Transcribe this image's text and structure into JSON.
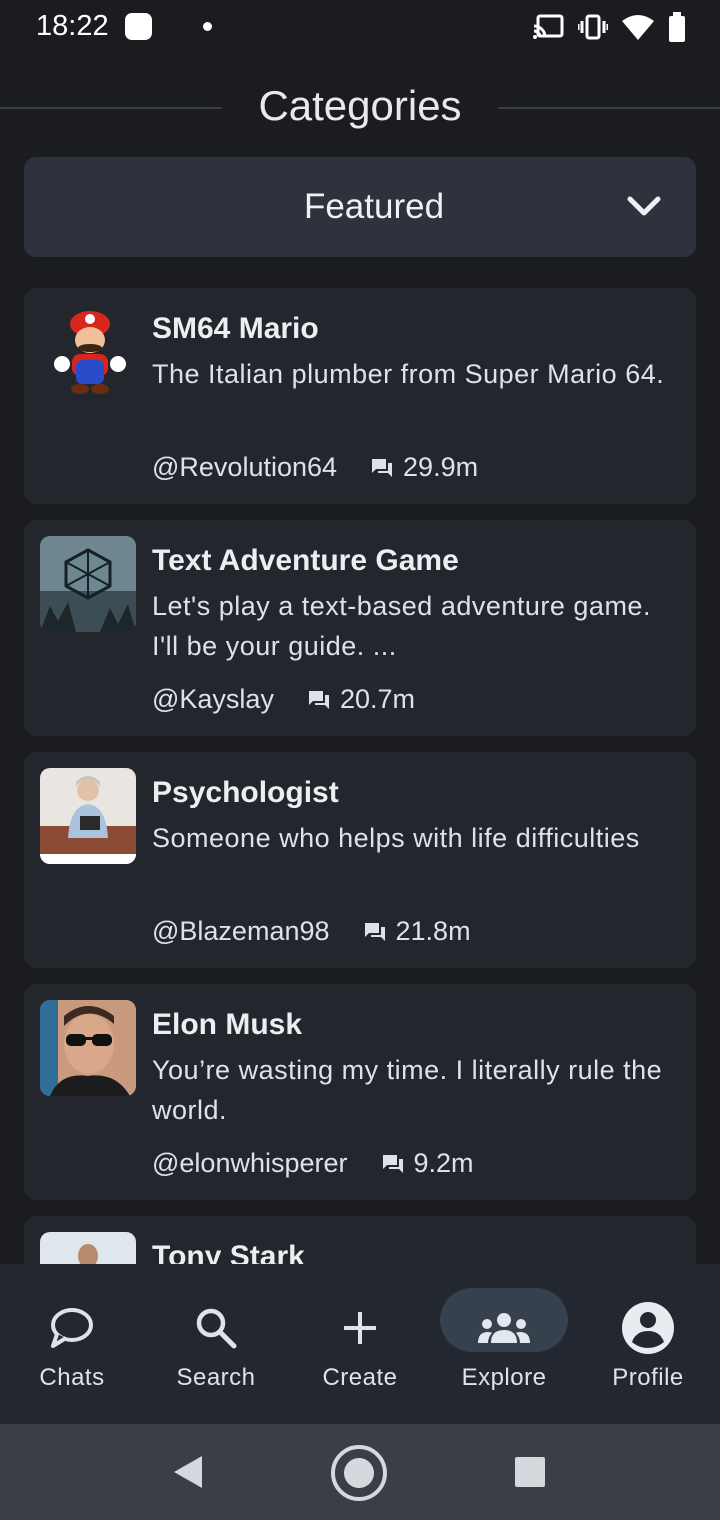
{
  "status_bar": {
    "time": "18:22",
    "icons": [
      "notification-square-icon",
      "dot-icon",
      "cast-icon",
      "vibrate-icon",
      "wifi-icon",
      "battery-icon"
    ]
  },
  "header": {
    "title": "Categories"
  },
  "category_select": {
    "selected": "Featured",
    "icon": "chevron-down-icon"
  },
  "characters": [
    {
      "name": "SM64 Mario",
      "description": "The Italian plumber from Super Mario 64.",
      "author": "@Revolution64",
      "chats": "29.9m"
    },
    {
      "name": "Text Adventure Game",
      "description": "Let's play a text-based adventure game. I'll be your guide. ...",
      "author": "@Kayslay",
      "chats": "20.7m"
    },
    {
      "name": "Psychologist",
      "description": "Someone who helps with life difficulties",
      "author": "@Blazeman98",
      "chats": "21.8m"
    },
    {
      "name": "Elon Musk",
      "description": "You’re wasting my time. I literally rule the world.",
      "author": "@elonwhisperer",
      "chats": "9.2m"
    },
    {
      "name": "Tony Stark",
      "description": "",
      "author": "",
      "chats": ""
    }
  ],
  "bottom_nav": [
    {
      "label": "Chats",
      "icon": "chat-bubble-icon",
      "active": false
    },
    {
      "label": "Search",
      "icon": "search-icon",
      "active": false
    },
    {
      "label": "Create",
      "icon": "plus-icon",
      "active": false
    },
    {
      "label": "Explore",
      "icon": "group-icon",
      "active": true
    },
    {
      "label": "Profile",
      "icon": "account-circle-icon",
      "active": false
    }
  ],
  "system_nav": [
    "back-icon",
    "home-icon",
    "recents-icon"
  ],
  "colors": {
    "background": "#1b1c20",
    "card": "#24262d",
    "dropdown": "#2d323c",
    "nav_active": "#37404d"
  }
}
